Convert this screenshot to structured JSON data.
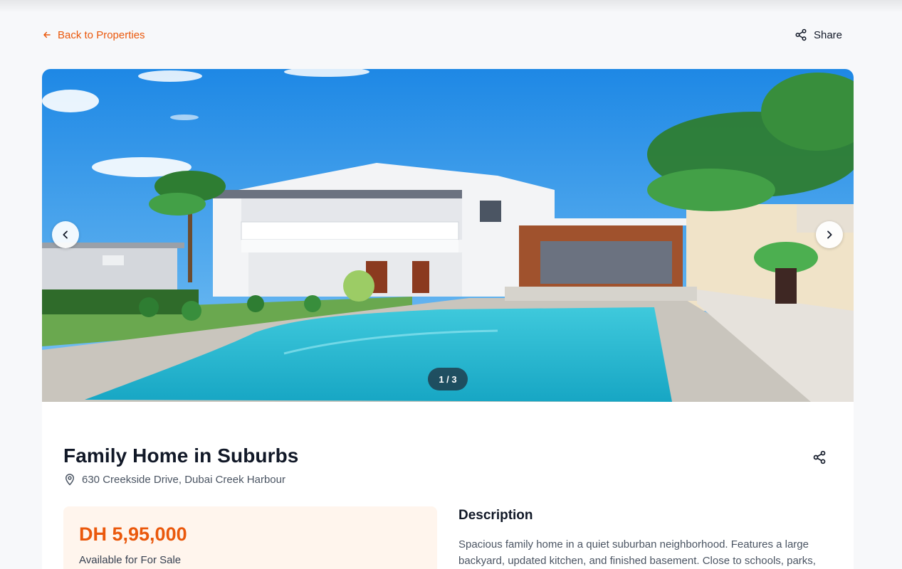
{
  "topbar": {
    "back_label": "Back to Properties",
    "share_label": "Share"
  },
  "gallery": {
    "counter": "1 / 3",
    "current": 1,
    "total": 3
  },
  "property": {
    "title": "Family Home in Suburbs",
    "address": "630 Creekside Drive, Dubai Creek Harbour",
    "price": "DH 5,95,000",
    "availability": "Available for For Sale"
  },
  "description": {
    "heading": "Description",
    "text": "Spacious family home in a quiet suburban neighborhood. Features a large backyard, updated kitchen, and finished basement. Close to schools, parks, and"
  },
  "colors": {
    "accent": "#ea580c",
    "price_bg": "#fff5ed",
    "page_bg": "#f7f8fa"
  },
  "icons": {
    "back": "arrow-left-icon",
    "share": "share-icon",
    "location": "map-pin-icon",
    "prev": "chevron-left-icon",
    "next": "chevron-right-icon"
  }
}
